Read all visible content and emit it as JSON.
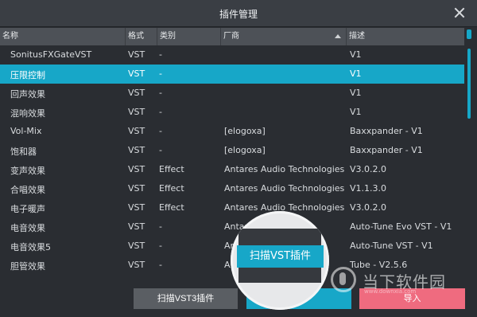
{
  "window": {
    "title": "插件管理"
  },
  "header": {
    "columns": [
      "名称",
      "格式",
      "类别",
      "厂商",
      "描述"
    ]
  },
  "rows": [
    {
      "name": "SonitusFXGateVST",
      "format": "VST",
      "category": "-",
      "vendor": "",
      "desc": "V1",
      "selected": false
    },
    {
      "name": "压限控制",
      "format": "VST",
      "category": "-",
      "vendor": "",
      "desc": "V1",
      "selected": true
    },
    {
      "name": "回声效果",
      "format": "VST",
      "category": "-",
      "vendor": "",
      "desc": "V1",
      "selected": false
    },
    {
      "name": "混响效果",
      "format": "VST",
      "category": "-",
      "vendor": "",
      "desc": "V1",
      "selected": false
    },
    {
      "name": "Vol-Mix",
      "format": "VST",
      "category": "-",
      "vendor": "[elogoxa]",
      "desc": "Baxxpander - V1",
      "selected": false
    },
    {
      "name": "饱和器",
      "format": "VST",
      "category": "-",
      "vendor": "[elogoxa]",
      "desc": "Baxxpander - V1",
      "selected": false
    },
    {
      "name": "变声效果",
      "format": "VST",
      "category": "Effect",
      "vendor": "Antares Audio Technologies",
      "desc": "V3.0.2.0",
      "selected": false
    },
    {
      "name": "合唱效果",
      "format": "VST",
      "category": "Effect",
      "vendor": "Antares Audio Technologies",
      "desc": "V1.1.3.0",
      "selected": false
    },
    {
      "name": "电子暖声",
      "format": "VST",
      "category": "Effect",
      "vendor": "Antares Audio Technologies",
      "desc": "V3.0.2.0",
      "selected": false
    },
    {
      "name": "电音效果",
      "format": "VST",
      "category": "-",
      "vendor": "Antar",
      "desc": "Auto-Tune Evo VST - V1",
      "selected": false
    },
    {
      "name": "电音效果5",
      "format": "VST",
      "category": "-",
      "vendor": "An",
      "desc": "Auto-Tune VST - V1",
      "selected": false
    },
    {
      "name": "胆管效果",
      "format": "VST",
      "category": "-",
      "vendor": "An",
      "desc": "Tube - V2.5.6",
      "selected": false
    }
  ],
  "buttons": {
    "scan_vst3": "扫描VST3插件",
    "scan_vst": "扫描VST插件",
    "scan_vst_partial": "插件",
    "import": "导入"
  },
  "magnifier": {
    "label": "扫描VST插件"
  },
  "watermark": {
    "text": "当下软件园",
    "sub": "www.downxia.com"
  },
  "colors": {
    "accent": "#17a7c8",
    "import": "#ef6b7f",
    "neutral_button": "#5a5e63",
    "background": "#2a2d32"
  },
  "icons": {
    "close": "close-icon",
    "sort": "sort-ascending-icon"
  }
}
